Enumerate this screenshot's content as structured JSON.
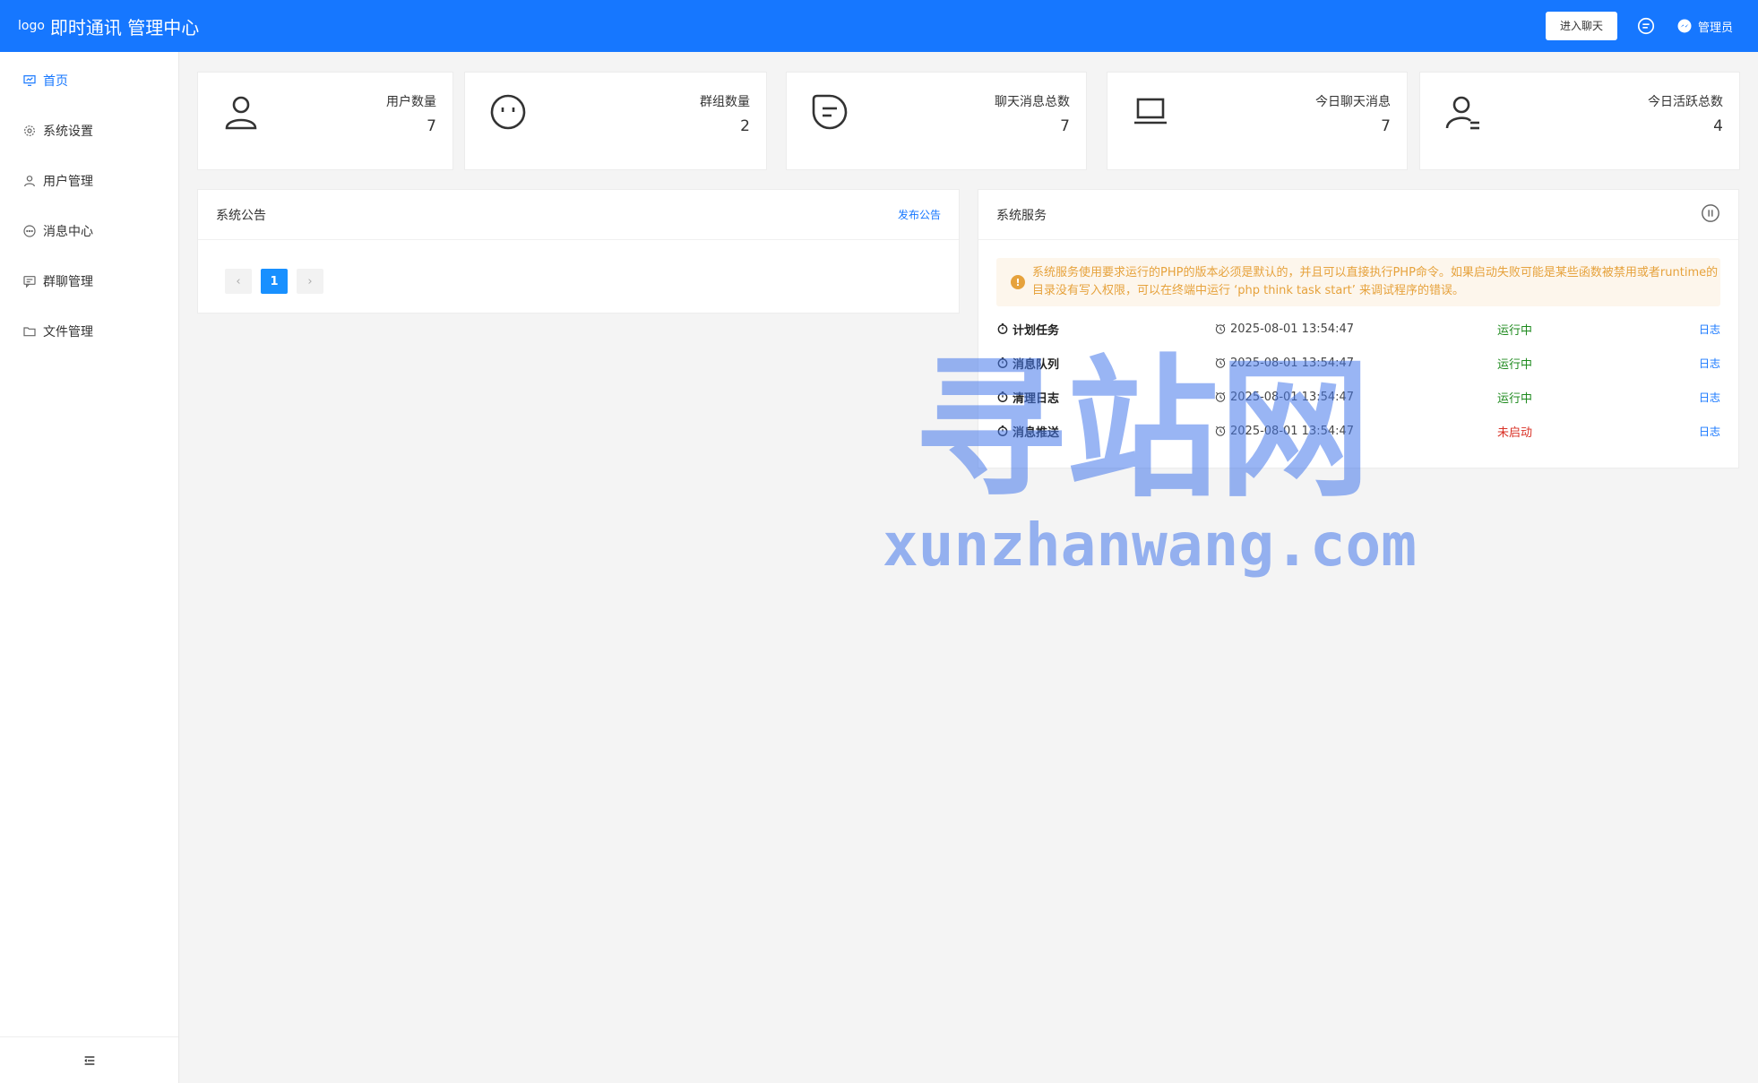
{
  "header": {
    "logo_alt": "logo",
    "title": "即时通讯 管理中心",
    "enter_chat": "进入聊天",
    "admin_name": "管理员",
    "brand_color": "#1677ff"
  },
  "sidebar": {
    "items": [
      {
        "label": "首页",
        "icon": "dashboard-icon",
        "active": true
      },
      {
        "label": "系统设置",
        "icon": "gear-icon"
      },
      {
        "label": "用户管理",
        "icon": "user-icon"
      },
      {
        "label": "消息中心",
        "icon": "chat-bubble-icon"
      },
      {
        "label": "群聊管理",
        "icon": "group-chat-icon"
      },
      {
        "label": "文件管理",
        "icon": "folder-icon"
      }
    ]
  },
  "stats": [
    {
      "label": "用户数量",
      "value": "7",
      "icon": "user-icon"
    },
    {
      "label": "群组数量",
      "value": "2",
      "icon": "face-icon"
    },
    {
      "label": "聊天消息总数",
      "value": "7",
      "icon": "message-icon"
    },
    {
      "label": "今日聊天消息",
      "value": "7",
      "icon": "laptop-icon"
    },
    {
      "label": "今日活跃总数",
      "value": "4",
      "icon": "user-active-icon"
    }
  ],
  "announcement": {
    "title": "系统公告",
    "publish": "发布公告",
    "pager": {
      "prev": "‹",
      "current": "1",
      "next": "›"
    }
  },
  "services": {
    "title": "系统服务",
    "notice": "系统服务使用要求运行的PHP的版本必须是默认的，并且可以直接执行PHP命令。如果启动失败可能是某些函数被禁用或者runtime的目录没有写入权限，可以在终端中运行 ‘php think task start’ 来调试程序的错误。",
    "rows": [
      {
        "name": "计划任务",
        "time": "2025-08-01 13:54:47",
        "status": "运行中",
        "log": "日志"
      },
      {
        "name": "消息队列",
        "time": "2025-08-01 13:54:47",
        "status": "运行中",
        "log": "日志"
      },
      {
        "name": "清理日志",
        "time": "2025-08-01 13:54:47",
        "status": "运行中",
        "log": "日志"
      },
      {
        "name": "消息推送",
        "time": "2025-08-01 13:54:47",
        "status": "未启动",
        "log": "日志"
      }
    ],
    "status_colors": {
      "running": "#1e8a1e",
      "stopped": "#d93025"
    }
  },
  "watermark": {
    "cn": "寻站网",
    "en": "xunzhanwang.com"
  }
}
